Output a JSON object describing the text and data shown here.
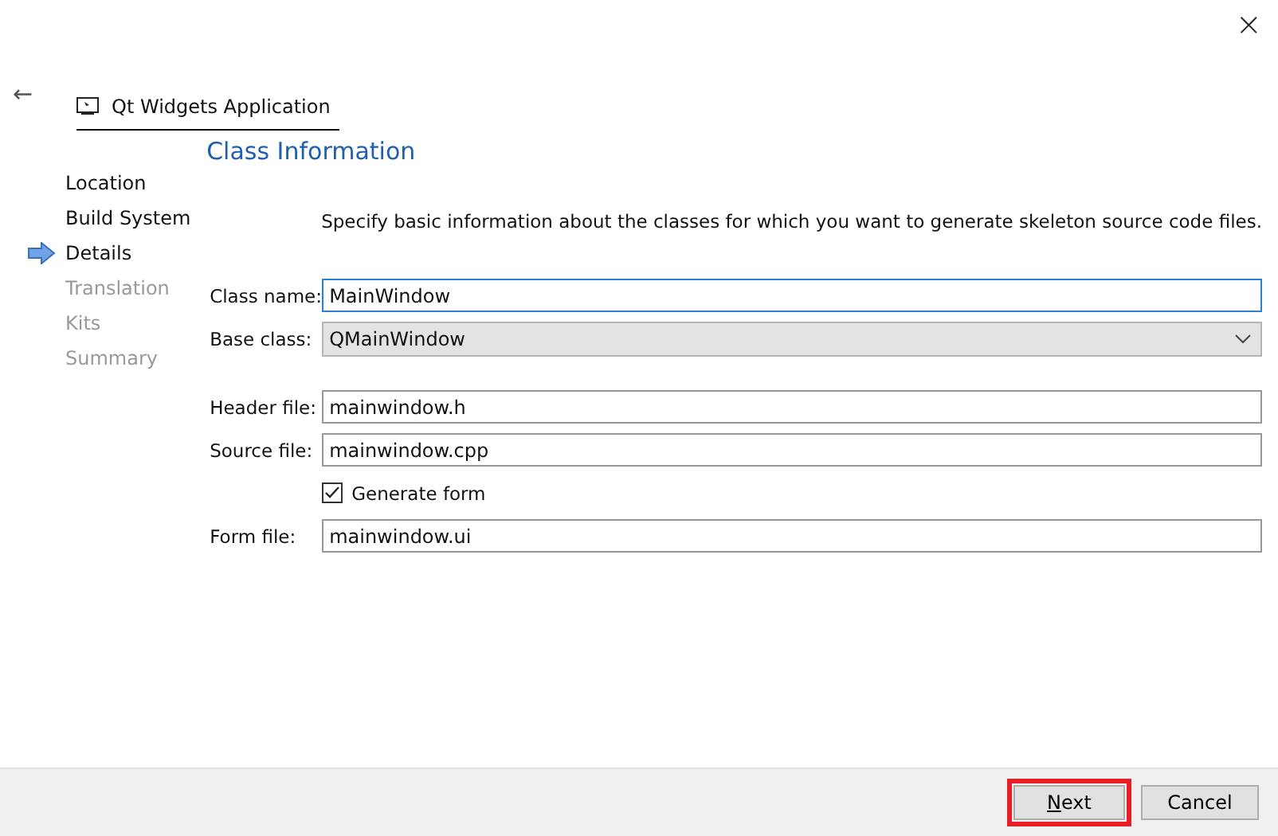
{
  "close_glyph": "×",
  "header": {
    "back_glyph": "←",
    "title": "Qt Widgets Application"
  },
  "steps": [
    {
      "label": "Location",
      "kind": "done"
    },
    {
      "label": "Build System",
      "kind": "done"
    },
    {
      "label": "Details",
      "kind": "current"
    },
    {
      "label": "Translation",
      "kind": "pending"
    },
    {
      "label": "Kits",
      "kind": "pending"
    },
    {
      "label": "Summary",
      "kind": "pending"
    }
  ],
  "page": {
    "title": "Class Information",
    "description": "Specify basic information about the classes for which you want to generate skeleton source code files.",
    "fields": [
      {
        "kind": "text",
        "label": "Class name:",
        "value": "MainWindow",
        "focused": true
      },
      {
        "kind": "combo",
        "label": "Base class:",
        "value": "QMainWindow"
      },
      {
        "kind": "spacer"
      },
      {
        "kind": "text",
        "label": "Header file:",
        "value": "mainwindow.h",
        "focused": false
      },
      {
        "kind": "text",
        "label": "Source file:",
        "value": "mainwindow.cpp",
        "focused": false
      },
      {
        "kind": "checkbox",
        "label": "Generate form",
        "checked": true
      },
      {
        "kind": "text",
        "label": "Form file:",
        "value": "mainwindow.ui",
        "focused": false
      }
    ]
  },
  "buttons": [
    {
      "label": "Next",
      "highlighted": true
    },
    {
      "label": "Cancel",
      "highlighted": false
    }
  ]
}
